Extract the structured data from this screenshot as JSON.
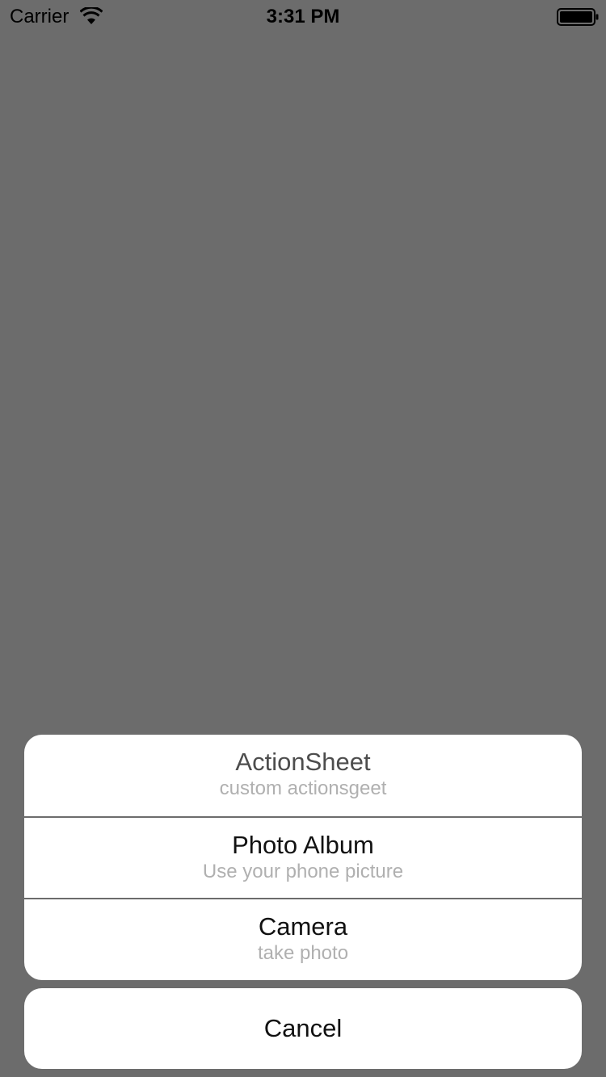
{
  "status_bar": {
    "carrier": "Carrier",
    "time": "3:31 PM",
    "wifi_icon": "wifi-icon",
    "battery_icon": "battery-icon"
  },
  "action_sheet": {
    "title": "ActionSheet",
    "subtitle": "custom actionsgeet",
    "options": [
      {
        "title": "Photo Album",
        "subtitle": "Use your phone picture"
      },
      {
        "title": "Camera",
        "subtitle": "take photo"
      }
    ],
    "cancel_label": "Cancel"
  },
  "colors": {
    "overlay": "#6c6c6c",
    "sheet_background": "#ffffff",
    "subtitle_text": "#b0b0b0"
  }
}
